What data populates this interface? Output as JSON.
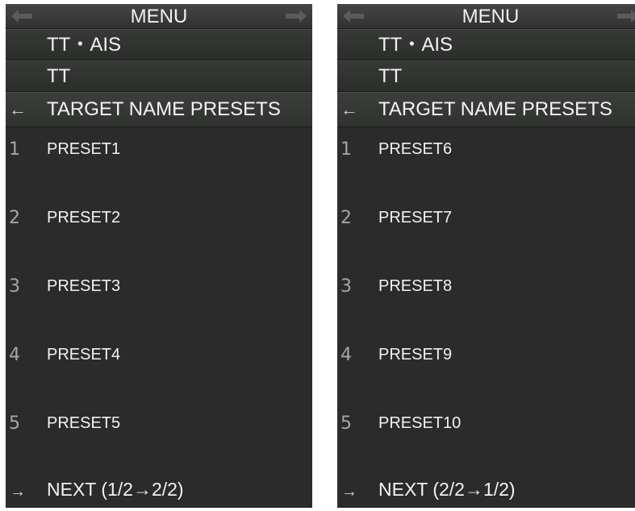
{
  "panels": [
    {
      "title": "MENU",
      "left_arrow": "←",
      "right_arrow": "→",
      "sub_items": [
        "TT・AIS",
        "TT"
      ],
      "back_arrow": "←",
      "header": "TARGET NAME PRESETS",
      "presets": [
        {
          "num": "1",
          "label": "PRESET1"
        },
        {
          "num": "2",
          "label": "PRESET2"
        },
        {
          "num": "3",
          "label": "PRESET3"
        },
        {
          "num": "4",
          "label": "PRESET4"
        },
        {
          "num": "5",
          "label": "PRESET5"
        }
      ],
      "next_arrow": "→",
      "next_label": "NEXT (1/2→2/2)"
    },
    {
      "title": "MENU",
      "left_arrow": "←",
      "right_arrow": "→",
      "sub_items": [
        "TT・AIS",
        "TT"
      ],
      "back_arrow": "←",
      "header": "TARGET NAME PRESETS",
      "presets": [
        {
          "num": "1",
          "label": "PRESET6"
        },
        {
          "num": "2",
          "label": "PRESET7"
        },
        {
          "num": "3",
          "label": "PRESET8"
        },
        {
          "num": "4",
          "label": "PRESET9"
        },
        {
          "num": "5",
          "label": "PRESET10"
        }
      ],
      "next_arrow": "→",
      "next_label": "NEXT (2/2→1/2)"
    }
  ],
  "colors": {
    "panel_bg": "#2a2b2a",
    "row_bg": "#343634",
    "text": "#f2f2f2",
    "number": "#a6a6a6",
    "arrow_dim": "#5a5c5a",
    "page_bg": "#ffffff"
  },
  "icons": {
    "title_left": "arrow-left-icon",
    "title_right": "arrow-right-icon",
    "back": "back-arrow-icon",
    "next": "next-arrow-icon"
  }
}
